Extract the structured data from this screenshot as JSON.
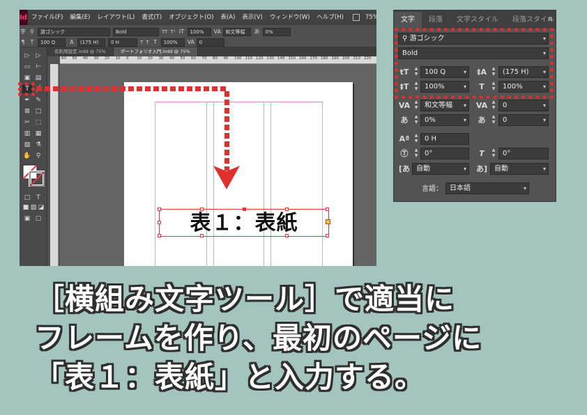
{
  "app": {
    "logo": "Id",
    "menus": [
      "ファイル(F)",
      "編集(E)",
      "レイアウト(L)",
      "書式(T)",
      "オブジェクト(O)",
      "表(A)",
      "表示(V)",
      "ウィンドウ(W)",
      "ヘルプ(H)"
    ],
    "zoom": "75%"
  },
  "control_bar": {
    "font": "游ゴシック",
    "style": "Bold",
    "size": "100 Q",
    "leading": "(175 H)",
    "scale_v": "100%",
    "scale_h": "100%",
    "kerning": "和文等幅",
    "tracking": "0",
    "tsume": "0%",
    "baseline": "0 H"
  },
  "doc_tabs": [
    "名刺用設定.indd @ 75%",
    "ポートフォリオ入門.indd @ 75%"
  ],
  "ruler_numbers": [
    "60",
    "50",
    "40",
    "30",
    "20",
    "10",
    "0",
    "10",
    "20",
    "30",
    "40",
    "50",
    "60",
    "70",
    "80",
    "90",
    "100",
    "110",
    "120",
    "130",
    "140",
    "150",
    "160",
    "170",
    "180",
    "190",
    "200",
    "210",
    "220"
  ],
  "document": {
    "frame_text": "表１：表紙"
  },
  "character_panel": {
    "tabs": [
      "文字",
      "段落",
      "文字スタイル",
      "段落スタイル"
    ],
    "font_family": "游ゴシック",
    "font_style": "Bold",
    "font_size": "100 Q",
    "leading": "(175 H)",
    "vertical_scale": "100%",
    "horizontal_scale": "100%",
    "kerning": "和文等幅",
    "tracking": "0",
    "tsume": "0%",
    "aki": "0",
    "baseline_shift": "0 H",
    "character_rotation": "0°",
    "skew": "0°",
    "mojikumi_before": "自動",
    "mojikumi_after": "自動",
    "language_label": "言語：",
    "language": "日本語"
  },
  "caption": {
    "line1": "［横組み文字ツール］で適当に",
    "line2": "フレームを作り、最初のページに",
    "line3": "「表１：表紙」と入力する。"
  },
  "colors": {
    "background": "#a4c5be",
    "highlight": "#e0302c",
    "ui_dark": "#535353"
  }
}
